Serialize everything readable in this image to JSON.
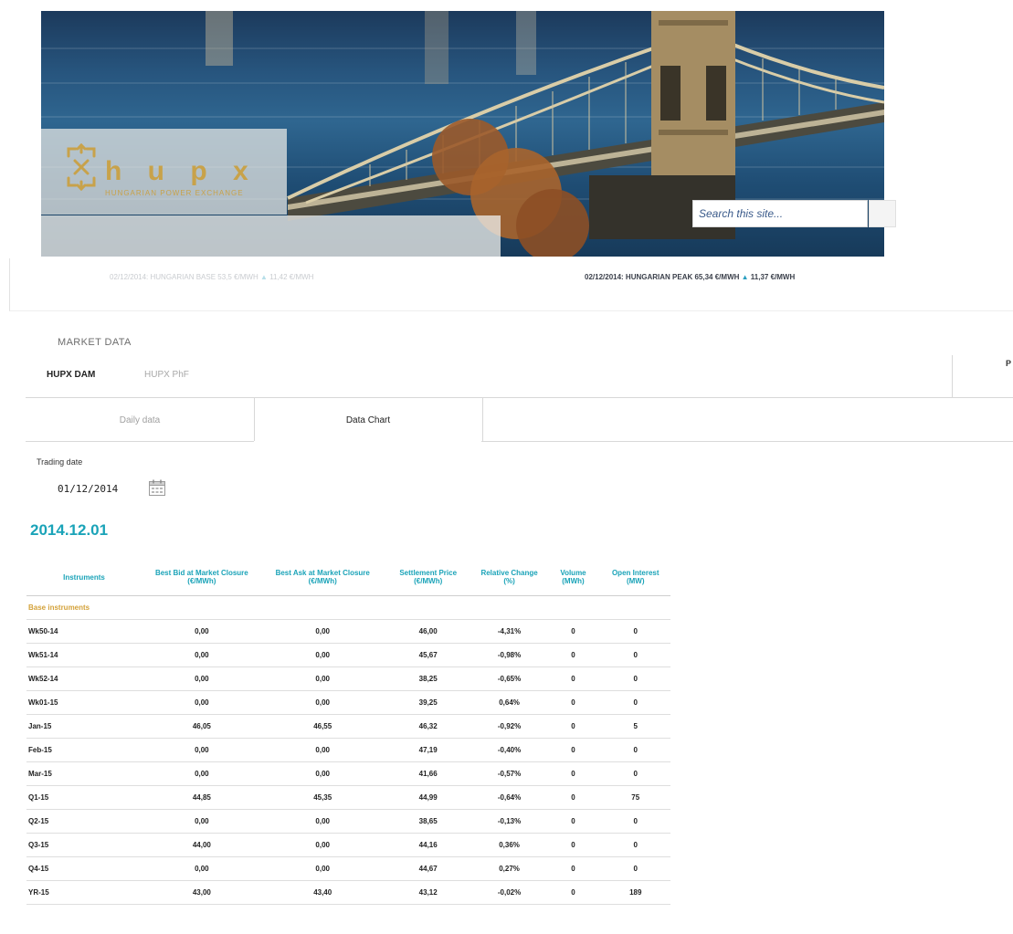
{
  "header": {
    "logo_text": "h u p x",
    "logo_subtitle": "HUNGARIAN POWER EXCHANGE",
    "search_placeholder": "Search this site..."
  },
  "ticker": {
    "base": {
      "prefix": "02/12/2014: HUNGARIAN BASE 53,5 €/MWH",
      "arrow": "▲",
      "change": "11,42 €/MWH"
    },
    "peak": {
      "prefix": "02/12/2014: HUNGARIAN PEAK 65,34 €/MWH",
      "arrow": "▲",
      "change": "11,37 €/MWH"
    }
  },
  "nav": {
    "section_title": "MARKET DATA",
    "tabs": [
      {
        "label": "HUPX DAM",
        "active": true
      },
      {
        "label": "HUPX PhF",
        "active": false
      }
    ],
    "right_edge_label": "P",
    "subtabs": [
      {
        "label": "Daily data",
        "active": false
      },
      {
        "label": "Data Chart",
        "active": true
      }
    ]
  },
  "trading": {
    "label": "Trading date",
    "value": "01/12/2014",
    "heading": "2014.12.01"
  },
  "table": {
    "columns": [
      "Instruments",
      "Best Bid at Market Closure (€/MWh)",
      "Best Ask at Market Closure (€/MWh)",
      "Settlement Price (€/MWh)",
      "Relative Change (%)",
      "Volume (MWh)",
      "Open Interest (MW)"
    ],
    "group_label": "Base instruments",
    "rows": [
      [
        "Wk50-14",
        "0,00",
        "0,00",
        "46,00",
        "-4,31%",
        "0",
        "0"
      ],
      [
        "Wk51-14",
        "0,00",
        "0,00",
        "45,67",
        "-0,98%",
        "0",
        "0"
      ],
      [
        "Wk52-14",
        "0,00",
        "0,00",
        "38,25",
        "-0,65%",
        "0",
        "0"
      ],
      [
        "Wk01-15",
        "0,00",
        "0,00",
        "39,25",
        "0,64%",
        "0",
        "0"
      ],
      [
        "Jan-15",
        "46,05",
        "46,55",
        "46,32",
        "-0,92%",
        "0",
        "5"
      ],
      [
        "Feb-15",
        "0,00",
        "0,00",
        "47,19",
        "-0,40%",
        "0",
        "0"
      ],
      [
        "Mar-15",
        "0,00",
        "0,00",
        "41,66",
        "-0,57%",
        "0",
        "0"
      ],
      [
        "Q1-15",
        "44,85",
        "45,35",
        "44,99",
        "-0,64%",
        "0",
        "75"
      ],
      [
        "Q2-15",
        "0,00",
        "0,00",
        "38,65",
        "-0,13%",
        "0",
        "0"
      ],
      [
        "Q3-15",
        "44,00",
        "0,00",
        "44,16",
        "0,36%",
        "0",
        "0"
      ],
      [
        "Q4-15",
        "0,00",
        "0,00",
        "44,67",
        "0,27%",
        "0",
        "0"
      ],
      [
        "YR-15",
        "43,00",
        "43,40",
        "43,12",
        "-0,02%",
        "0",
        "189"
      ]
    ]
  }
}
